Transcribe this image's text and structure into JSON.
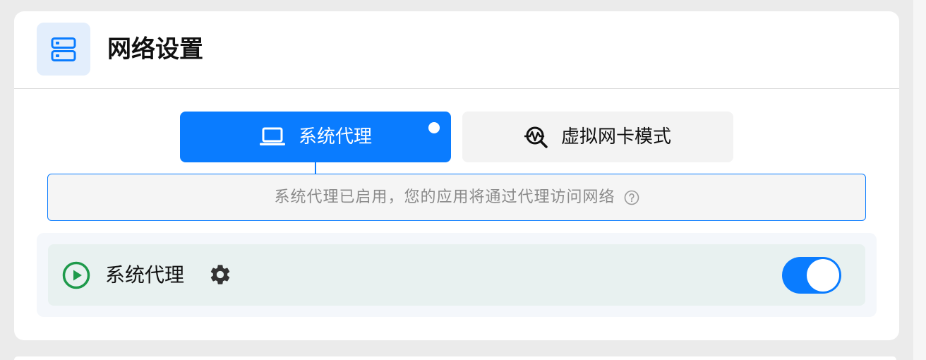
{
  "header": {
    "title": "网络设置",
    "icon": "server-icon"
  },
  "tabs": [
    {
      "label": "系统代理",
      "icon": "laptop-icon",
      "active": true
    },
    {
      "label": "虚拟网卡模式",
      "icon": "network-search-icon",
      "active": false
    }
  ],
  "info": {
    "text": "系统代理已启用，您的应用将通过代理访问网络",
    "icon": "help-circle-icon"
  },
  "proxy_row": {
    "label": "系统代理",
    "status_icon": "play-circle-icon",
    "settings_icon": "gear-icon",
    "toggle_enabled": true
  },
  "colors": {
    "accent": "#0a7cff",
    "status_running": "#1e9a4b",
    "icon_box_bg": "#e3eefc",
    "row_bg": "#e8f1f0"
  }
}
